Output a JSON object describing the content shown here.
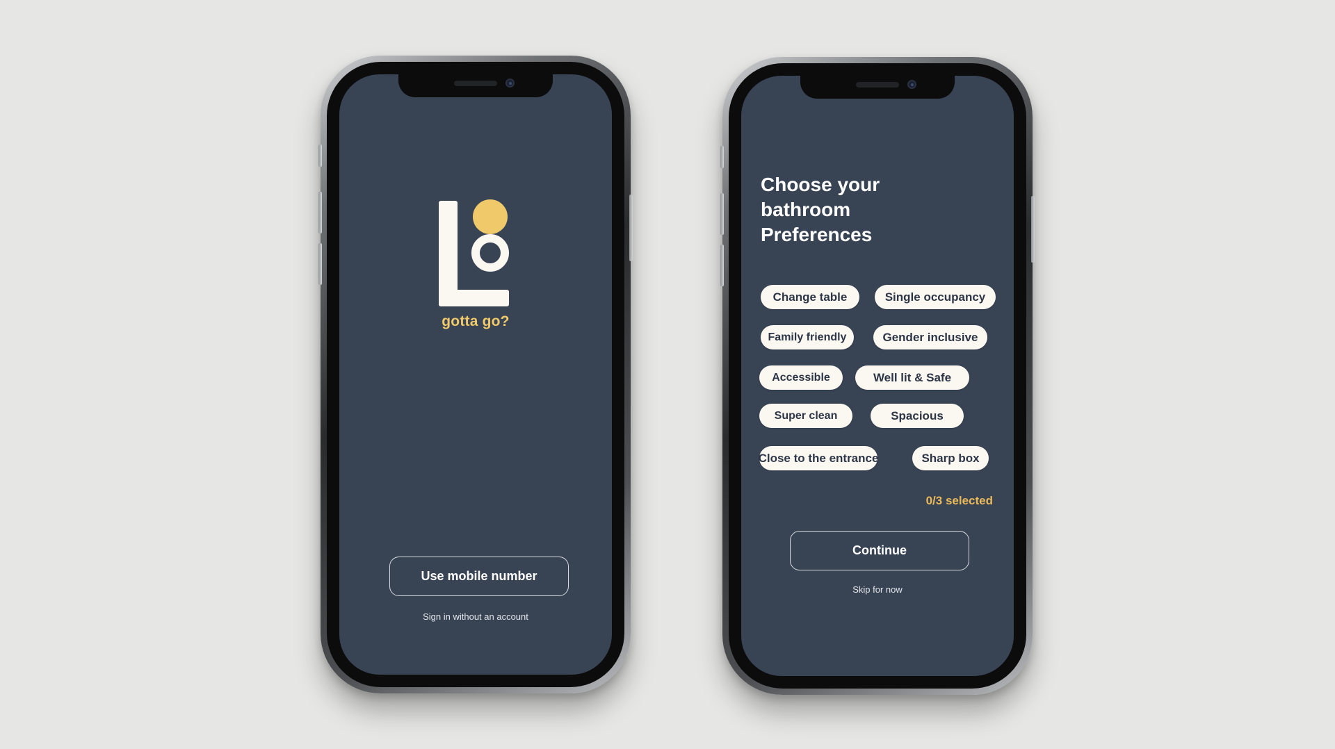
{
  "screen_welcome": {
    "tagline": "gotta go?",
    "primary_button": "Use mobile number",
    "secondary_link": "Sign in without an account"
  },
  "screen_preferences": {
    "heading_line1": "Choose your",
    "heading_line2": "bathroom",
    "heading_line3": "Preferences",
    "chips": [
      "Change table",
      "Single occupancy",
      "Family friendly",
      "Gender inclusive",
      "Accessible",
      "Well lit & Safe",
      "Super clean",
      "Spacious",
      "Close to the entrance",
      "Sharp box"
    ],
    "selected_counter": "0/3 selected",
    "continue_button": "Continue",
    "skip_link": "Skip for now"
  },
  "colors": {
    "screen_background": "#384354",
    "accent_yellow": "#f0c96b",
    "chip_background": "#fbf8f2",
    "page_background": "#e6e6e5"
  },
  "icons": {
    "logo": "lo-logo-icon",
    "camera": "front-camera-icon"
  }
}
